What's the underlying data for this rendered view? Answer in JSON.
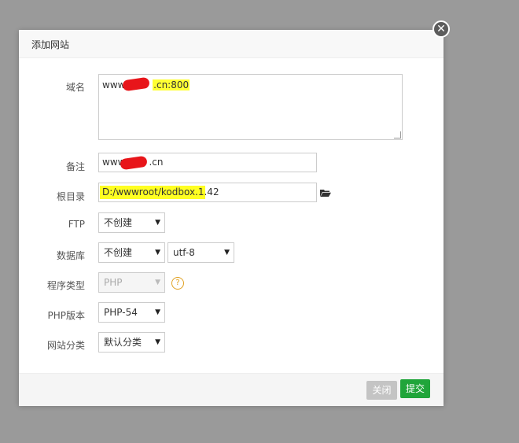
{
  "dialog": {
    "title": "添加网站",
    "close_glyph": "✕"
  },
  "form": {
    "domain": {
      "label": "域名",
      "value_prefix": "www.",
      "value_suffix": ".cn:800"
    },
    "remark": {
      "label": "备注",
      "value_prefix": "www",
      "value_suffix": ".cn"
    },
    "root_dir": {
      "label": "根目录",
      "value": "D:/wwwroot/kodbox.1.42"
    },
    "ftp": {
      "label": "FTP",
      "selected": "不创建"
    },
    "database": {
      "label": "数据库",
      "selected": "不创建",
      "charset": "utf-8"
    },
    "program_type": {
      "label": "程序类型",
      "selected": "PHP",
      "help_glyph": "?"
    },
    "php_version": {
      "label": "PHP版本",
      "selected": "PHP-54"
    },
    "site_category": {
      "label": "网站分类",
      "selected": "默认分类"
    }
  },
  "footer": {
    "close_label": "关闭",
    "submit_label": "提交"
  },
  "icons": {
    "folder": "folder-icon",
    "chevron": "chevron-down-icon",
    "help": "question-circle-icon",
    "close": "close-icon"
  },
  "colors": {
    "backdrop": "#9a9a9a",
    "submit": "#20a53a",
    "close_button": "#c4c4c4",
    "highlight": "#ffff22",
    "redaction": "#e8151a",
    "help": "#e0a020"
  }
}
